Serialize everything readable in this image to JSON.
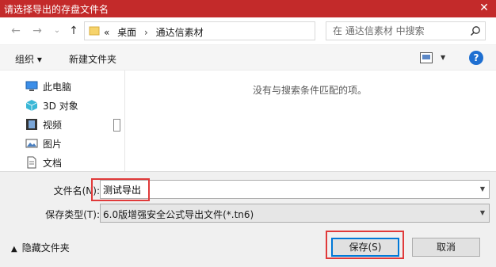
{
  "window": {
    "title": "请选择导出的存盘文件名",
    "close_glyph": "✕"
  },
  "nav": {
    "back_glyph": "←",
    "forward_glyph": "→",
    "history_glyph": "⌄",
    "up_glyph": "↑",
    "address": {
      "overflow": "«",
      "crumbs": [
        "桌面",
        "通达信素材"
      ],
      "separator": "›"
    },
    "refresh_glyph": "↻",
    "search_placeholder": "在 通达信素材 中搜索"
  },
  "toolbar": {
    "organize": "组织 ▾",
    "new_folder": "新建文件夹",
    "help": "?"
  },
  "sidebar": {
    "items": [
      {
        "label": "此电脑",
        "icon": "computer-icon"
      },
      {
        "label": "3D 对象",
        "icon": "cube-3d-icon"
      },
      {
        "label": "视频",
        "icon": "video-icon"
      },
      {
        "label": "图片",
        "icon": "picture-icon"
      },
      {
        "label": "文档",
        "icon": "document-icon"
      }
    ]
  },
  "content": {
    "empty_message": "没有与搜索条件匹配的项。"
  },
  "form": {
    "filename_label": "文件名(N):",
    "filename_value": "测试导出",
    "filetype_label": "保存类型(T):",
    "filetype_value": "6.0版增强安全公式导出文件(*.tn6)",
    "hide_folders": "隐藏文件夹",
    "save": "保存(S)",
    "cancel": "取消"
  },
  "colors": {
    "titlebar": "#c32a2a",
    "highlight": "#e03a3a",
    "accent": "#0078d7"
  }
}
